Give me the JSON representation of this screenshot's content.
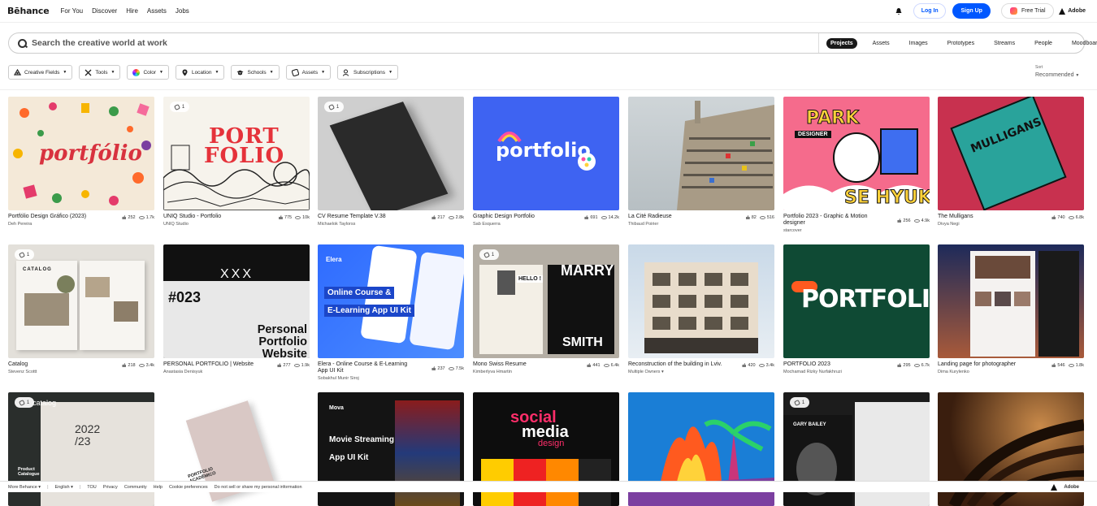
{
  "nav": {
    "logo": "Bēhance",
    "links": [
      "For You",
      "Discover",
      "Hire",
      "Assets",
      "Jobs"
    ],
    "login": "Log In",
    "signup": "Sign Up",
    "free_trial": "Free Trial",
    "adobe": "Adobe"
  },
  "search": {
    "placeholder": "Search the creative world at work",
    "tabs": [
      "Projects",
      "Assets",
      "Images",
      "Prototypes",
      "Streams",
      "People",
      "Moodboards"
    ],
    "active_tab": "Projects"
  },
  "filters": [
    "Creative Fields",
    "Tools",
    "Color",
    "Location",
    "Schools",
    "Assets",
    "Subscriptions"
  ],
  "sort": {
    "label": "Sort",
    "value": "Recommended"
  },
  "projects": [
    {
      "title": "Portfólio Design Gráfico (2023)",
      "owner": "Deh Pereira",
      "likes": "252",
      "views": "1.7k",
      "multi": ""
    },
    {
      "title": "UNIQ Studio - Portfolio",
      "owner": "UNIQ Studio",
      "likes": "775",
      "views": "10k",
      "multi": "1"
    },
    {
      "title": "CV Resume Template V.38",
      "owner": "Michaelok Taylorss",
      "likes": "217",
      "views": "2.8k",
      "multi": "1"
    },
    {
      "title": "Graphic Design Portfolio",
      "owner": "Sab Esquerra",
      "likes": "691",
      "views": "14.2k",
      "multi": ""
    },
    {
      "title": "La Cité Radieuse",
      "owner": "Thibaud Poirier",
      "likes": "82",
      "views": "516",
      "multi": ""
    },
    {
      "title": "Portfolio 2023 - Graphic & Motion designer",
      "owner": "starcover",
      "likes": "256",
      "views": "4.9k",
      "multi": ""
    },
    {
      "title": "The Mulligans",
      "owner": "Divya Negi",
      "likes": "740",
      "views": "6.8k",
      "multi": ""
    },
    {
      "title": "Catalog",
      "owner": "Stevenz Scottt",
      "likes": "218",
      "views": "3.4k",
      "multi": "1"
    },
    {
      "title": "PERSONAL PORTFOLIO | Website",
      "owner": "Anastasia Denisyuk",
      "likes": "277",
      "views": "1.9k",
      "multi": ""
    },
    {
      "title": "Elera - Online Course & E-Learning App UI Kit",
      "owner": "Sobakhul Munir Siroj",
      "likes": "237",
      "views": "7.5k",
      "multi": ""
    },
    {
      "title": "Mono Swiss Resume",
      "owner": "Kimberlyva Hmartin",
      "likes": "441",
      "views": "6.4k",
      "multi": "1"
    },
    {
      "title": "Reconstruction of the building in Lviv.",
      "owner": "Multiple Owners ▾",
      "likes": "420",
      "views": "3.4k",
      "multi": ""
    },
    {
      "title": "PORTFOLIO 2023",
      "owner": "Mochamad Rizky Nurfakhruzi",
      "likes": "295",
      "views": "6.7k",
      "multi": ""
    },
    {
      "title": "Landing page for photographer",
      "owner": "Dima Kurylenko",
      "likes": "546",
      "views": "1.8k",
      "multi": ""
    },
    {
      "title": "",
      "owner": "",
      "likes": "",
      "views": "",
      "multi": "1"
    },
    {
      "title": "",
      "owner": "",
      "likes": "",
      "views": "",
      "multi": ""
    },
    {
      "title": "",
      "owner": "",
      "likes": "",
      "views": "",
      "multi": ""
    },
    {
      "title": "",
      "owner": "",
      "likes": "",
      "views": "",
      "multi": ""
    },
    {
      "title": "",
      "owner": "",
      "likes": "",
      "views": "",
      "multi": ""
    },
    {
      "title": "",
      "owner": "",
      "likes": "",
      "views": "",
      "multi": "1"
    },
    {
      "title": "",
      "owner": "",
      "likes": "",
      "views": "",
      "multi": ""
    }
  ],
  "thumb_text": {
    "p1": "portfólio",
    "p2a": "PORT",
    "p2b": "FOLIO",
    "p4": "portfolio",
    "p6a": "PARK",
    "p6b": "SE HYUK",
    "p6c": "DESIGNER",
    "p7": "MULLIGANS",
    "p8": "CATALOG",
    "p9a": "#023",
    "p9b": "Personal Portfolio Website",
    "p9c": "XXX",
    "p10a": "Online Course &",
    "p10b": "E-Learning App UI Kit",
    "p10c": "Elera",
    "p11a": "MARRY",
    "p11b": "SMITH",
    "p11c": "HELLO !",
    "p13": "PORTFOLIO",
    "p15a": "catalog",
    "p15b": "2022 /23",
    "p15c": "Product Catalogue",
    "p16": "PORTFOLIO ACADÊMICO",
    "p17a": "Movie Streaming",
    "p17b": "App UI Kit",
    "p17c": "Mova",
    "p18a": "social",
    "p18b": "media",
    "p18c": "design",
    "p20": "GARY BAILEY"
  },
  "footer": {
    "items": [
      "More Behance ▾",
      "English ▾",
      "TOU",
      "Privacy",
      "Community",
      "Help",
      "Cookie preferences",
      "Do not sell or share my personal information"
    ],
    "adobe": "Adobe"
  },
  "colors": {
    "accent": "#0057ff",
    "text": "#191919"
  }
}
